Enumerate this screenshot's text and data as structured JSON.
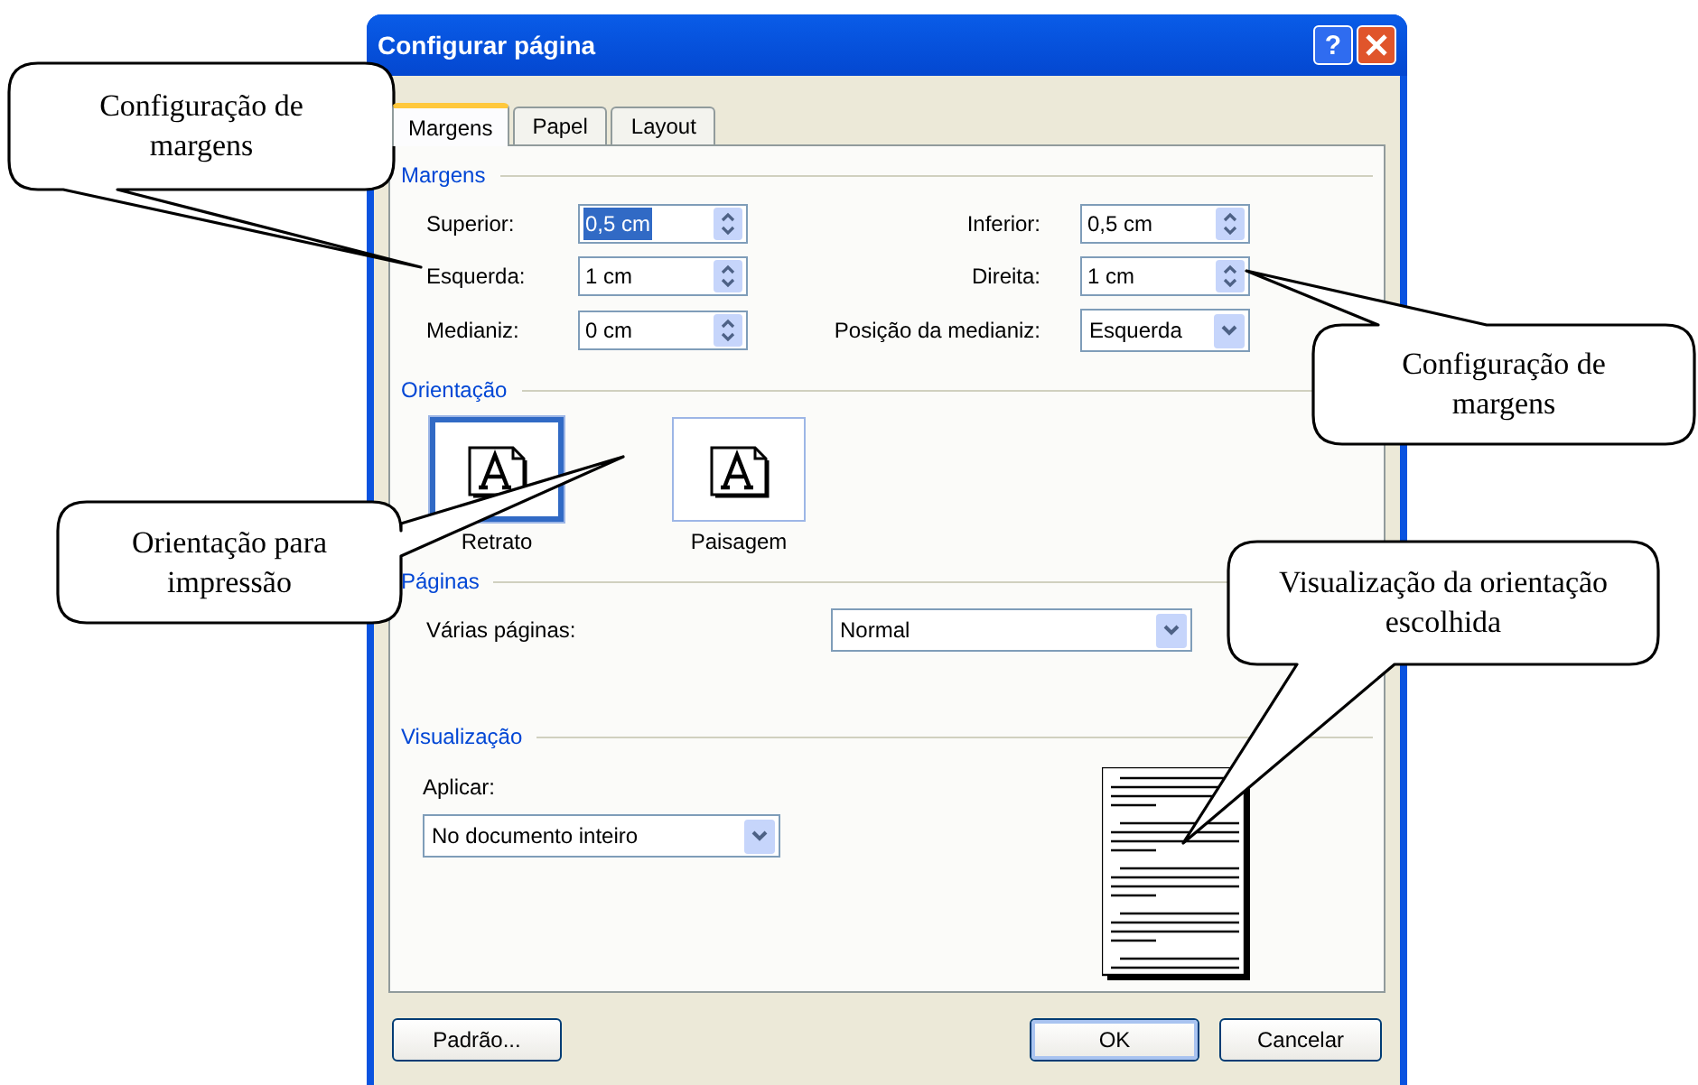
{
  "dialog": {
    "title": "Configurar página",
    "help_button": "?"
  },
  "tabs": [
    {
      "label": "Margens",
      "selected": true
    },
    {
      "label": "Papel",
      "selected": false
    },
    {
      "label": "Layout",
      "selected": false
    }
  ],
  "margins": {
    "heading": "Margens",
    "fields": [
      {
        "label": "Superior:",
        "value": "0,5 cm",
        "kind": "spin",
        "highlighted": true
      },
      {
        "label": "Inferior:",
        "value": "0,5 cm",
        "kind": "spin",
        "highlighted": false
      },
      {
        "label": "Esquerda:",
        "value": "1 cm",
        "kind": "spin",
        "highlighted": false
      },
      {
        "label": "Direita:",
        "value": "1 cm",
        "kind": "spin",
        "highlighted": false
      },
      {
        "label": "Medianiz:",
        "value": "0 cm",
        "kind": "spin",
        "highlighted": false
      },
      {
        "label": "Posição da medianiz:",
        "value": "Esquerda",
        "kind": "dropdown",
        "highlighted": false
      }
    ]
  },
  "orientation": {
    "heading": "Orientação",
    "options": [
      {
        "label": "Retrato",
        "selected": true
      },
      {
        "label": "Paisagem",
        "selected": false
      }
    ]
  },
  "pages": {
    "heading": "Páginas",
    "label": "Várias páginas:",
    "value": "Normal"
  },
  "preview": {
    "heading": "Visualização",
    "apply_label": "Aplicar:",
    "apply_value": "No documento inteiro"
  },
  "buttons": [
    {
      "label": "Padrão...",
      "default": false
    },
    {
      "label": "OK",
      "default": true
    },
    {
      "label": "Cancelar",
      "default": false
    }
  ],
  "callouts": [
    {
      "text": "Configuração de margens"
    },
    {
      "text": "Configuração de margens"
    },
    {
      "text": "Orientação para impressão"
    },
    {
      "text": "Visualização da orientação escolhida"
    }
  ]
}
